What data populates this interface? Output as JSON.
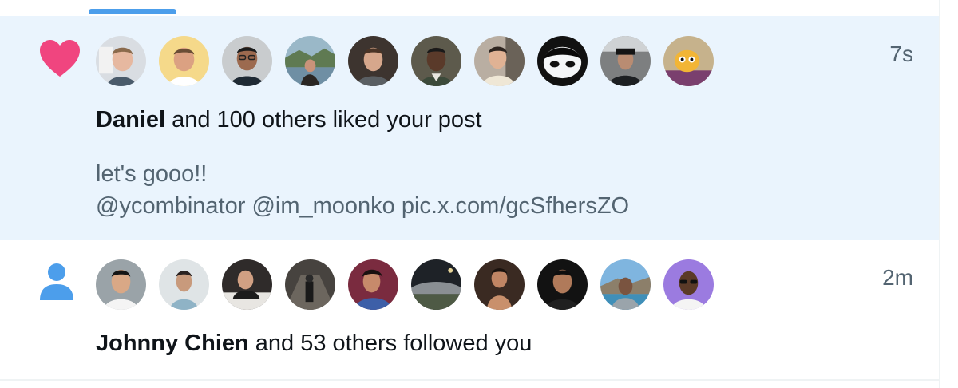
{
  "colors": {
    "tab_indicator": "#4c9eeb",
    "like_heart": "#f0457f",
    "follow_person": "#4c9eeb",
    "highlight_bg": "#eaf4fd",
    "secondary_text": "#536471"
  },
  "notifications": [
    {
      "type": "like",
      "icon": "heart-icon",
      "time": "7s",
      "actor": "Daniel",
      "action": " and 100 others liked your post",
      "post_lines": [
        "let's gooo!!",
        "@ycombinator @im_moonko pic.x.com/gcSfhersZO"
      ],
      "avatar_count": 10
    },
    {
      "type": "follow",
      "icon": "person-icon",
      "time": "2m",
      "actor": "Johnny Chien",
      "action": " and 53 others followed you",
      "avatar_count": 10
    }
  ]
}
